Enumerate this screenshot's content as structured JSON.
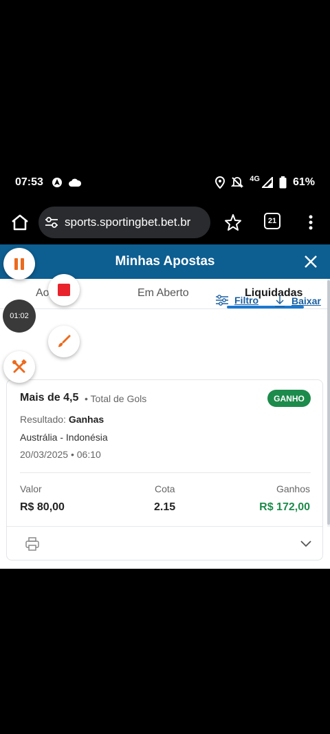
{
  "status_bar": {
    "time": "07:53",
    "network": "4G",
    "battery": "61%",
    "icons": [
      "android-auto-icon",
      "cloud-icon",
      "location-icon",
      "bell-off-icon",
      "signal-icon",
      "battery-icon"
    ]
  },
  "browser": {
    "url": "sports.sportingbet.bet.br",
    "tab_count": "21",
    "icons": [
      "home-icon",
      "tune-icon",
      "star-icon",
      "tabs-icon",
      "more-vert-icon"
    ]
  },
  "header": {
    "title": "Minhas Apostas"
  },
  "tabs": [
    {
      "label": "Ao"
    },
    {
      "label": "Em Aberto"
    },
    {
      "label": "Liquidadas",
      "active": true
    }
  ],
  "toolbar": {
    "filter_label": "Filtro",
    "download_label": "Baixar"
  },
  "bet": {
    "title": "Mais de 4,5",
    "market": "• Total de Gols",
    "status_badge": "GANHO",
    "result_label": "Resultado:",
    "result_value": "Ganhas",
    "match": "Austrália - Indonésia",
    "datetime": "20/03/2025 • 06:10",
    "columns": {
      "stake_label": "Valor",
      "stake_value": "R$ 80,00",
      "odds_label": "Cota",
      "odds_value": "2.15",
      "winnings_label": "Ganhos",
      "winnings_value": "R$ 172,00"
    }
  },
  "recorder_overlay": {
    "timer": "01:02"
  },
  "colors": {
    "header_bg": "#0d5e91",
    "link": "#1a5fa0",
    "win_green": "#1d8b4b",
    "tab_underline": "#1b79d0",
    "recorder_accent": "#ec6a1d"
  }
}
